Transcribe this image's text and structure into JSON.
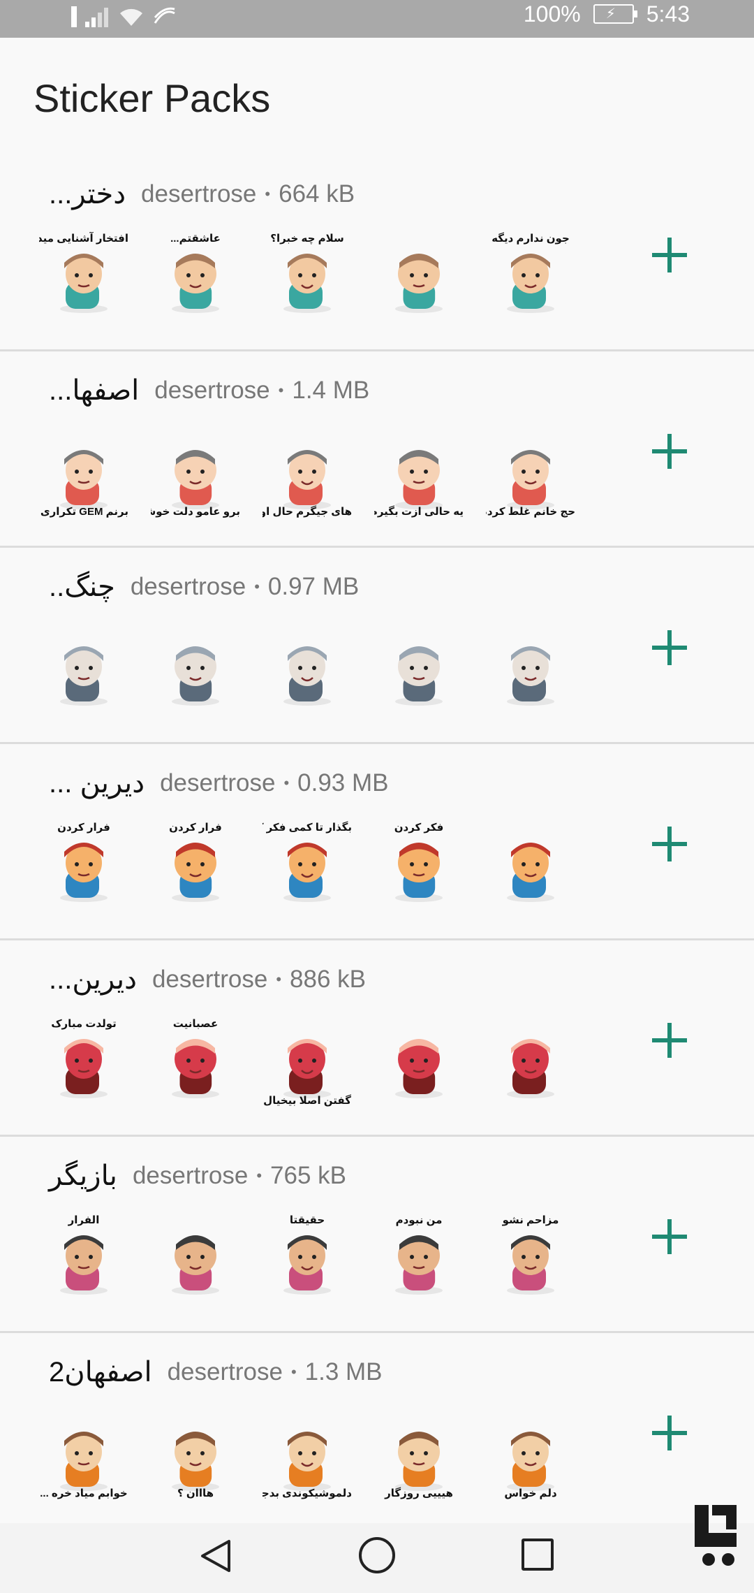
{
  "status_bar": {
    "battery": "100%",
    "time": "5:43"
  },
  "title": "Sticker Packs",
  "colors": {
    "accent": "#1f8a73",
    "divider": "#dcdcdc",
    "meta_text": "#777777"
  },
  "packs": [
    {
      "name": "دختر...",
      "publisher": "desertrose",
      "size": "664 kB",
      "stickers": [
        {
          "caption": "افتخار آشنایی میدی؟",
          "pos": "top"
        },
        {
          "caption": "عاشقتم...",
          "pos": "top"
        },
        {
          "caption": "سلام چه خبرا؟",
          "pos": "top"
        },
        {
          "caption": "",
          "pos": "top"
        },
        {
          "caption": "جون ندارم دیگه",
          "pos": "top"
        }
      ]
    },
    {
      "name": "اصفها...",
      "publisher": "desertrose",
      "size": "1.4 MB",
      "stickers": [
        {
          "caption": "برنم GEM تکراری قسمتی",
          "pos": "bottom"
        },
        {
          "caption": "برو عامو دلت خوشس",
          "pos": "bottom"
        },
        {
          "caption": "های جیگرم حال اومد",
          "pos": "bottom"
        },
        {
          "caption": "یه حالی ازت بگیرم من",
          "pos": "bottom"
        },
        {
          "caption": "حج خانم غلط کردم",
          "pos": "bottom"
        }
      ]
    },
    {
      "name": "چنگ..",
      "publisher": "desertrose",
      "size": "0.97 MB",
      "stickers": [
        {
          "caption": "",
          "pos": "top"
        },
        {
          "caption": "",
          "pos": "top"
        },
        {
          "caption": "",
          "pos": "top"
        },
        {
          "caption": "",
          "pos": "top"
        },
        {
          "caption": "",
          "pos": "top"
        }
      ]
    },
    {
      "name": "دیرین ...",
      "publisher": "desertrose",
      "size": "0.93 MB",
      "stickers": [
        {
          "caption": "فرار کردن",
          "pos": "top"
        },
        {
          "caption": "فرار کردن",
          "pos": "top"
        },
        {
          "caption": "بگذار تا کمی فکر کنم",
          "pos": "top"
        },
        {
          "caption": "فکر کردن",
          "pos": "top"
        },
        {
          "caption": "",
          "pos": "top"
        }
      ]
    },
    {
      "name": "دیرین...",
      "publisher": "desertrose",
      "size": "886 kB",
      "stickers": [
        {
          "caption": "تولدت مبارک",
          "pos": "top"
        },
        {
          "caption": "عصبانیت",
          "pos": "top"
        },
        {
          "caption": "گفتن اصلا بیخیال",
          "pos": "bottom"
        },
        {
          "caption": "",
          "pos": "top"
        },
        {
          "caption": "",
          "pos": "top"
        }
      ]
    },
    {
      "name": "بازیگر",
      "publisher": "desertrose",
      "size": "765 kB",
      "stickers": [
        {
          "caption": "الفرار",
          "pos": "top"
        },
        {
          "caption": "",
          "pos": "top"
        },
        {
          "caption": "حقیقتا",
          "pos": "top"
        },
        {
          "caption": "من نبودم",
          "pos": "top"
        },
        {
          "caption": "مزاحم نشو",
          "pos": "top"
        }
      ]
    },
    {
      "name": "اصفهان2",
      "publisher": "desertrose",
      "size": "1.3 MB",
      "stickers": [
        {
          "caption": "خوابم میاد خره ...",
          "pos": "bottom"
        },
        {
          "caption": "هااان ؟",
          "pos": "bottom"
        },
        {
          "caption": "دلموشیکوندی بدجور",
          "pos": "bottom"
        },
        {
          "caption": "هیییی روزگار",
          "pos": "bottom"
        },
        {
          "caption": "دلم خواس",
          "pos": "bottom"
        }
      ]
    }
  ]
}
